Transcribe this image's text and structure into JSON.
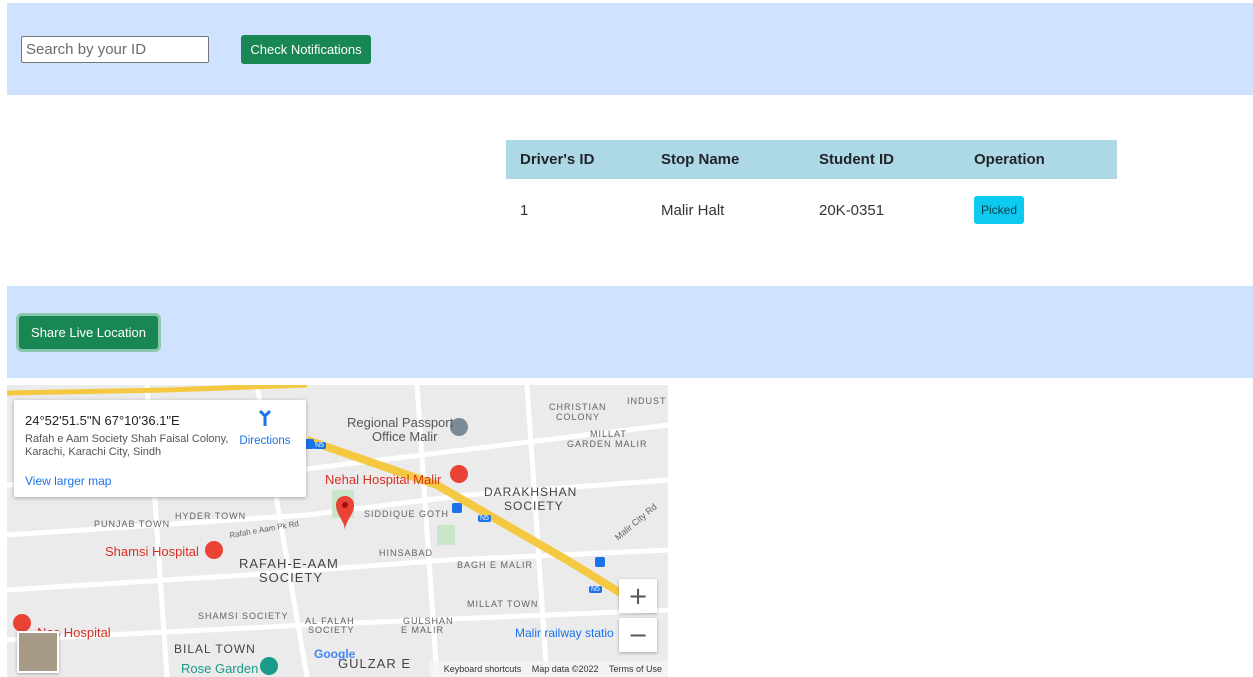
{
  "search": {
    "placeholder": "Search by your ID"
  },
  "toolbar": {
    "check_label": "Check Notifications",
    "share_label": "Share Live Location"
  },
  "table": {
    "headers": [
      "Driver's ID",
      "Stop Name",
      "Student ID",
      "Operation"
    ],
    "rows": [
      {
        "driver_id": "1",
        "stop_name": "Malir Halt",
        "student_id": "20K-0351",
        "operation": "Picked"
      }
    ]
  },
  "map": {
    "coords": "24°52'51.5\"N 67°10'36.1\"E",
    "address": "Rafah e Aam Society Shah Faisal Colony, Karachi, Karachi City, Sindh",
    "directions": "Directions",
    "view_larger": "View larger map",
    "labels": {
      "regional_passport_1": "Regional Passport",
      "regional_passport_2": "Office Malir",
      "christian_colony_1": "CHRISTIAN",
      "christian_colony_2": "COLONY",
      "industrial": "INDUST",
      "millat_garden_1": "MILLAT",
      "millat_garden_2": "GARDEN MALIR",
      "nehal_hospital": "Nehal Hospital Malir",
      "darakhshan_1": "DARAKHSHAN",
      "darakhshan_2": "SOCIETY",
      "hyder_town": "HYDER TOWN",
      "punjab_town": "PUNJAB TOWN",
      "siddique_goth": "SIDDIQUE GOTH",
      "rafah_pk_rd": "Rafah e Aam Pk Rd",
      "malir_city_rd": "Malir City Rd",
      "shamsi_hospital": "Shamsi Hospital",
      "rafah_society_1": "RAFAH-E-AAM",
      "rafah_society_2": "SOCIETY",
      "hinsabad": "HINSABAD",
      "bagh_e_malir": "BAGH E MALIR",
      "millat_town": "MILLAT TOWN",
      "shamsi_society": "SHAMSI SOCIETY",
      "al_falah_1": "AL FALAH",
      "al_falah_2": "SOCIETY",
      "gulshan_1": "GULSHAN",
      "gulshan_2": "E MALIR",
      "nas_hospital": "Nas Hospital",
      "bilal_town": "BILAL TOWN",
      "rose_garden": "Rose Garden",
      "gulzar": "GULZAR E",
      "malir_railway": "Malir railway statio",
      "n5": "N5"
    },
    "zoom_in": "+",
    "zoom_out": "−",
    "google": "Google",
    "attribution": {
      "shortcuts": "Keyboard shortcuts",
      "data": "Map data ©2022",
      "terms": "Terms of Use"
    },
    "colors": {
      "road": "#f5c842",
      "marker": "#ea4335",
      "park": "#c8e6c9"
    }
  }
}
